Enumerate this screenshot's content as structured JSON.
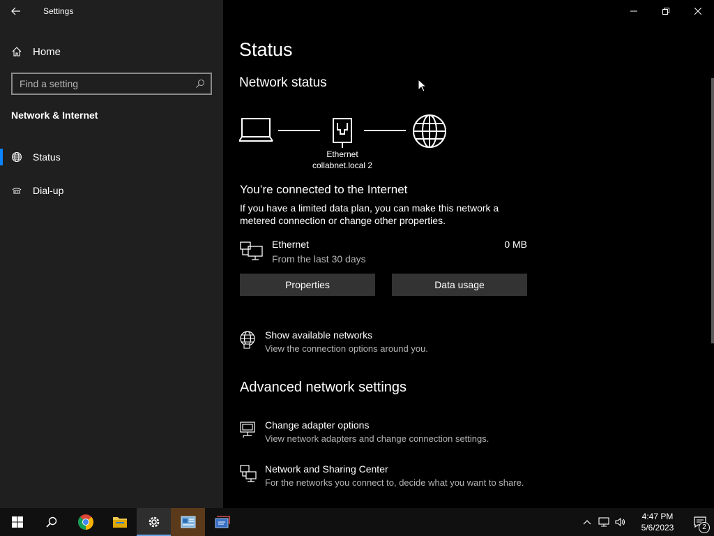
{
  "window": {
    "title": "Settings"
  },
  "sidebar": {
    "home_label": "Home",
    "search_placeholder": "Find a setting",
    "section_title": "Network & Internet",
    "items": [
      {
        "label": "Status",
        "icon": "globe-icon",
        "active": true
      },
      {
        "label": "Dial-up",
        "icon": "dialup-icon",
        "active": false
      }
    ]
  },
  "main": {
    "title": "Status",
    "network_status_heading": "Network status",
    "adapter_name": "Ethernet",
    "network_name": "collabnet.local 2",
    "connected_heading": "You’re connected to the Internet",
    "connected_desc": "If you have a limited data plan, you can make this network a metered connection or change other properties.",
    "ethernet": {
      "name": "Ethernet",
      "period": "From the last 30 days",
      "usage": "0 MB"
    },
    "buttons": {
      "properties": "Properties",
      "data_usage": "Data usage"
    },
    "show_networks": {
      "title": "Show available networks",
      "subtitle": "View the connection options around you."
    },
    "advanced_heading": "Advanced network settings",
    "change_adapter": {
      "title": "Change adapter options",
      "subtitle": "View network adapters and change connection settings."
    },
    "sharing_center": {
      "title": "Network and Sharing Center",
      "subtitle": "For the networks you connect to, decide what you want to share."
    }
  },
  "taskbar": {
    "time": "4:47 PM",
    "date": "5/6/2023",
    "notification_count": "2",
    "accent": "#6aa5e8"
  }
}
